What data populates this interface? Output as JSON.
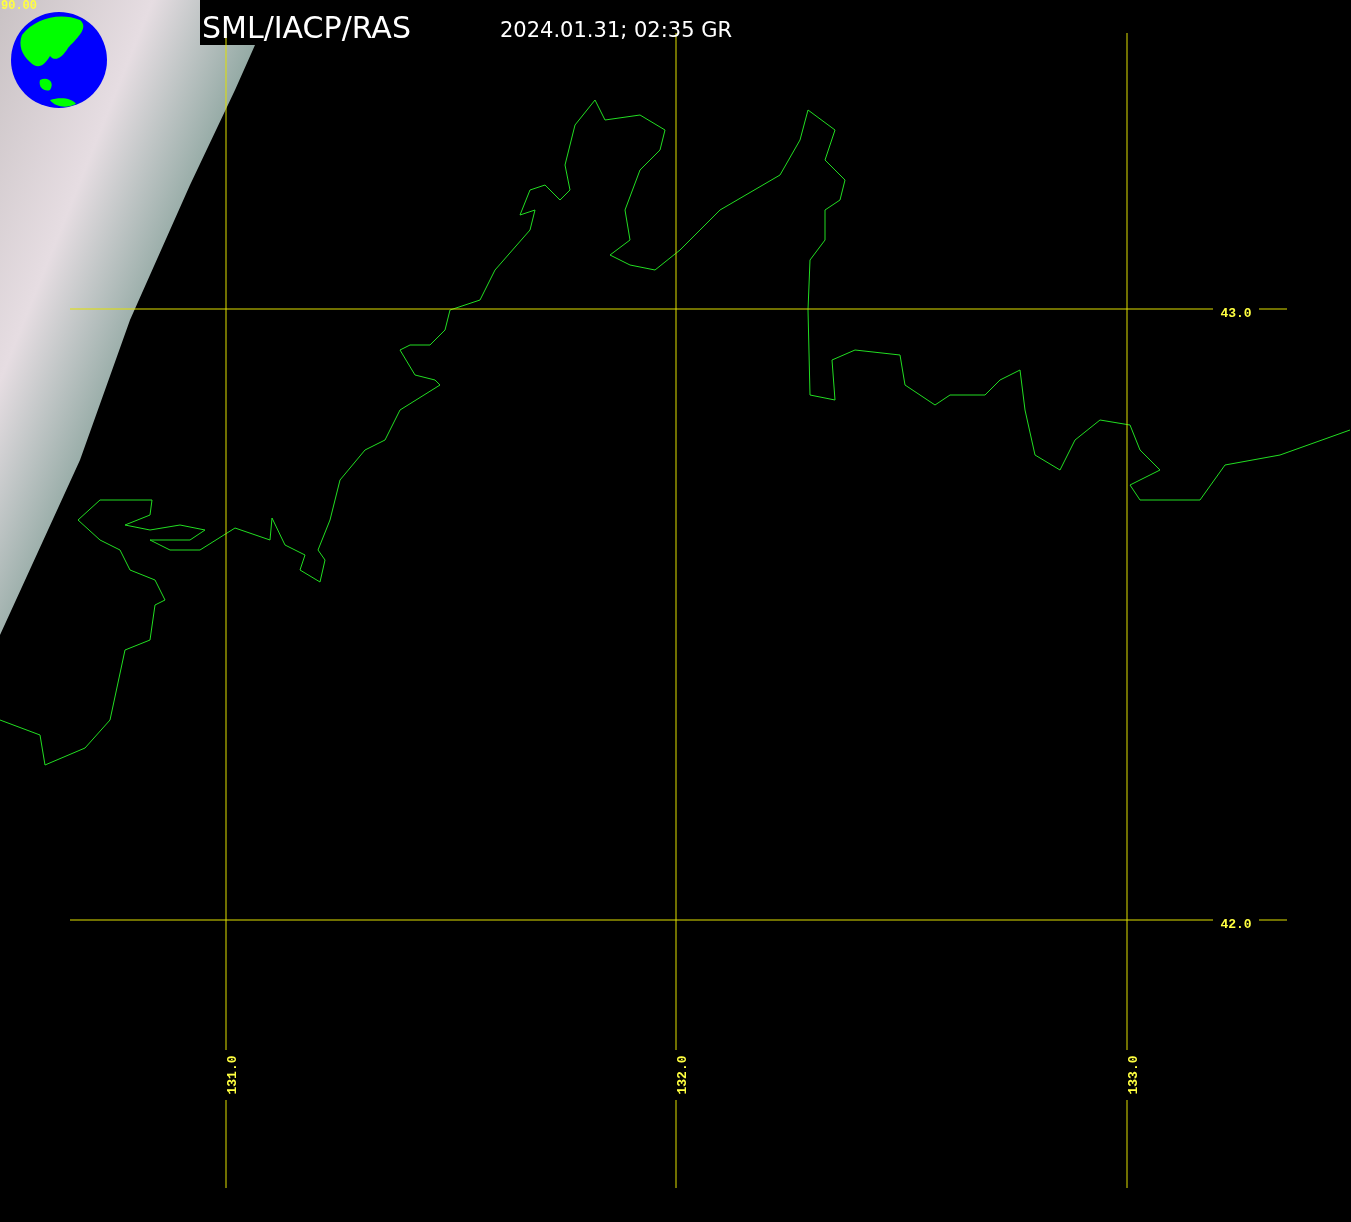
{
  "corner_label": "90.00",
  "title": "SML/IACP/RAS",
  "timestamp": "2024.01.31; 02:35 GR",
  "latitude_labels": [
    "43.0",
    "42.0"
  ],
  "longitude_labels": [
    "131.0",
    "132.0",
    "133.0"
  ]
}
